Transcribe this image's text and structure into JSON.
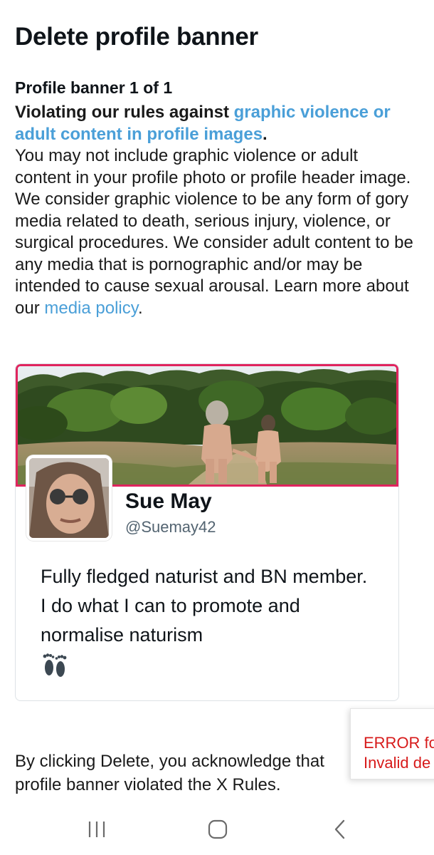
{
  "header": {
    "title": "Delete profile banner"
  },
  "violation": {
    "counter": "Profile banner 1 of 1",
    "lead": "Violating our rules against ",
    "rule_link": "graphic violence or adult content in profile images",
    "lead_end": ".",
    "description": "You may not include graphic violence or adult content in your profile photo or profile header image. We consider graphic violence to be any form of gory media related to death, serious injury, violence, or surgical procedures. We consider adult content to be any media that is pornographic and/or may be intended to cause sexual arousal. Learn more about our ",
    "policy_link": "media policy",
    "description_end": "."
  },
  "profile": {
    "display_name": "Sue May",
    "handle": "@Suemay42",
    "bio": "Fully fledged naturist and BN member. I do what I can to promote and normalise naturism",
    "bio_icon": "footprints-icon"
  },
  "error_toast": {
    "line1": "ERROR fo",
    "line2": "Invalid de"
  },
  "acknowledgement": {
    "text": "By clicking Delete, you acknowledge that profile banner violated the X Rules."
  },
  "navigation": {
    "recents_icon": "recent-apps-icon",
    "home_icon": "home-icon",
    "back_icon": "back-icon"
  },
  "colors": {
    "link": "#4a9fd8",
    "banner_border": "#e0245e",
    "error": "#d71a1a",
    "handle": "#536471"
  }
}
